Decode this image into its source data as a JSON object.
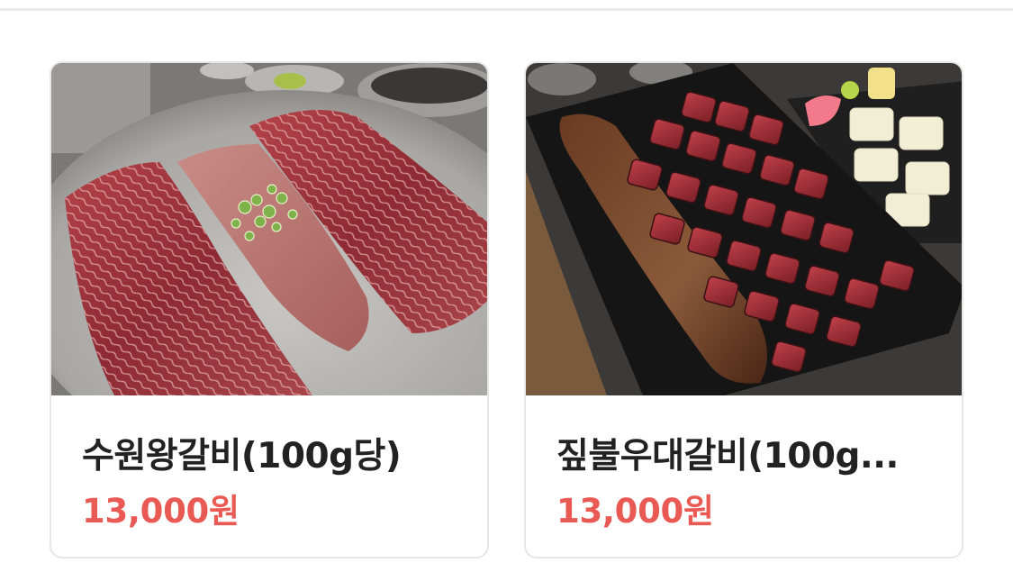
{
  "products": [
    {
      "name": "수원왕갈비(100g당)",
      "price": "13,000원",
      "image_icon": "marinated-beef-rib-on-steel-plate"
    },
    {
      "name": "짚불우대갈비(100g...",
      "price": "13,000원",
      "image_icon": "grilled-cubed-beef-rib-on-black-plate"
    }
  ],
  "colors": {
    "price": "#ea5a55",
    "name": "#222222",
    "card_border": "#e6e6e6"
  }
}
